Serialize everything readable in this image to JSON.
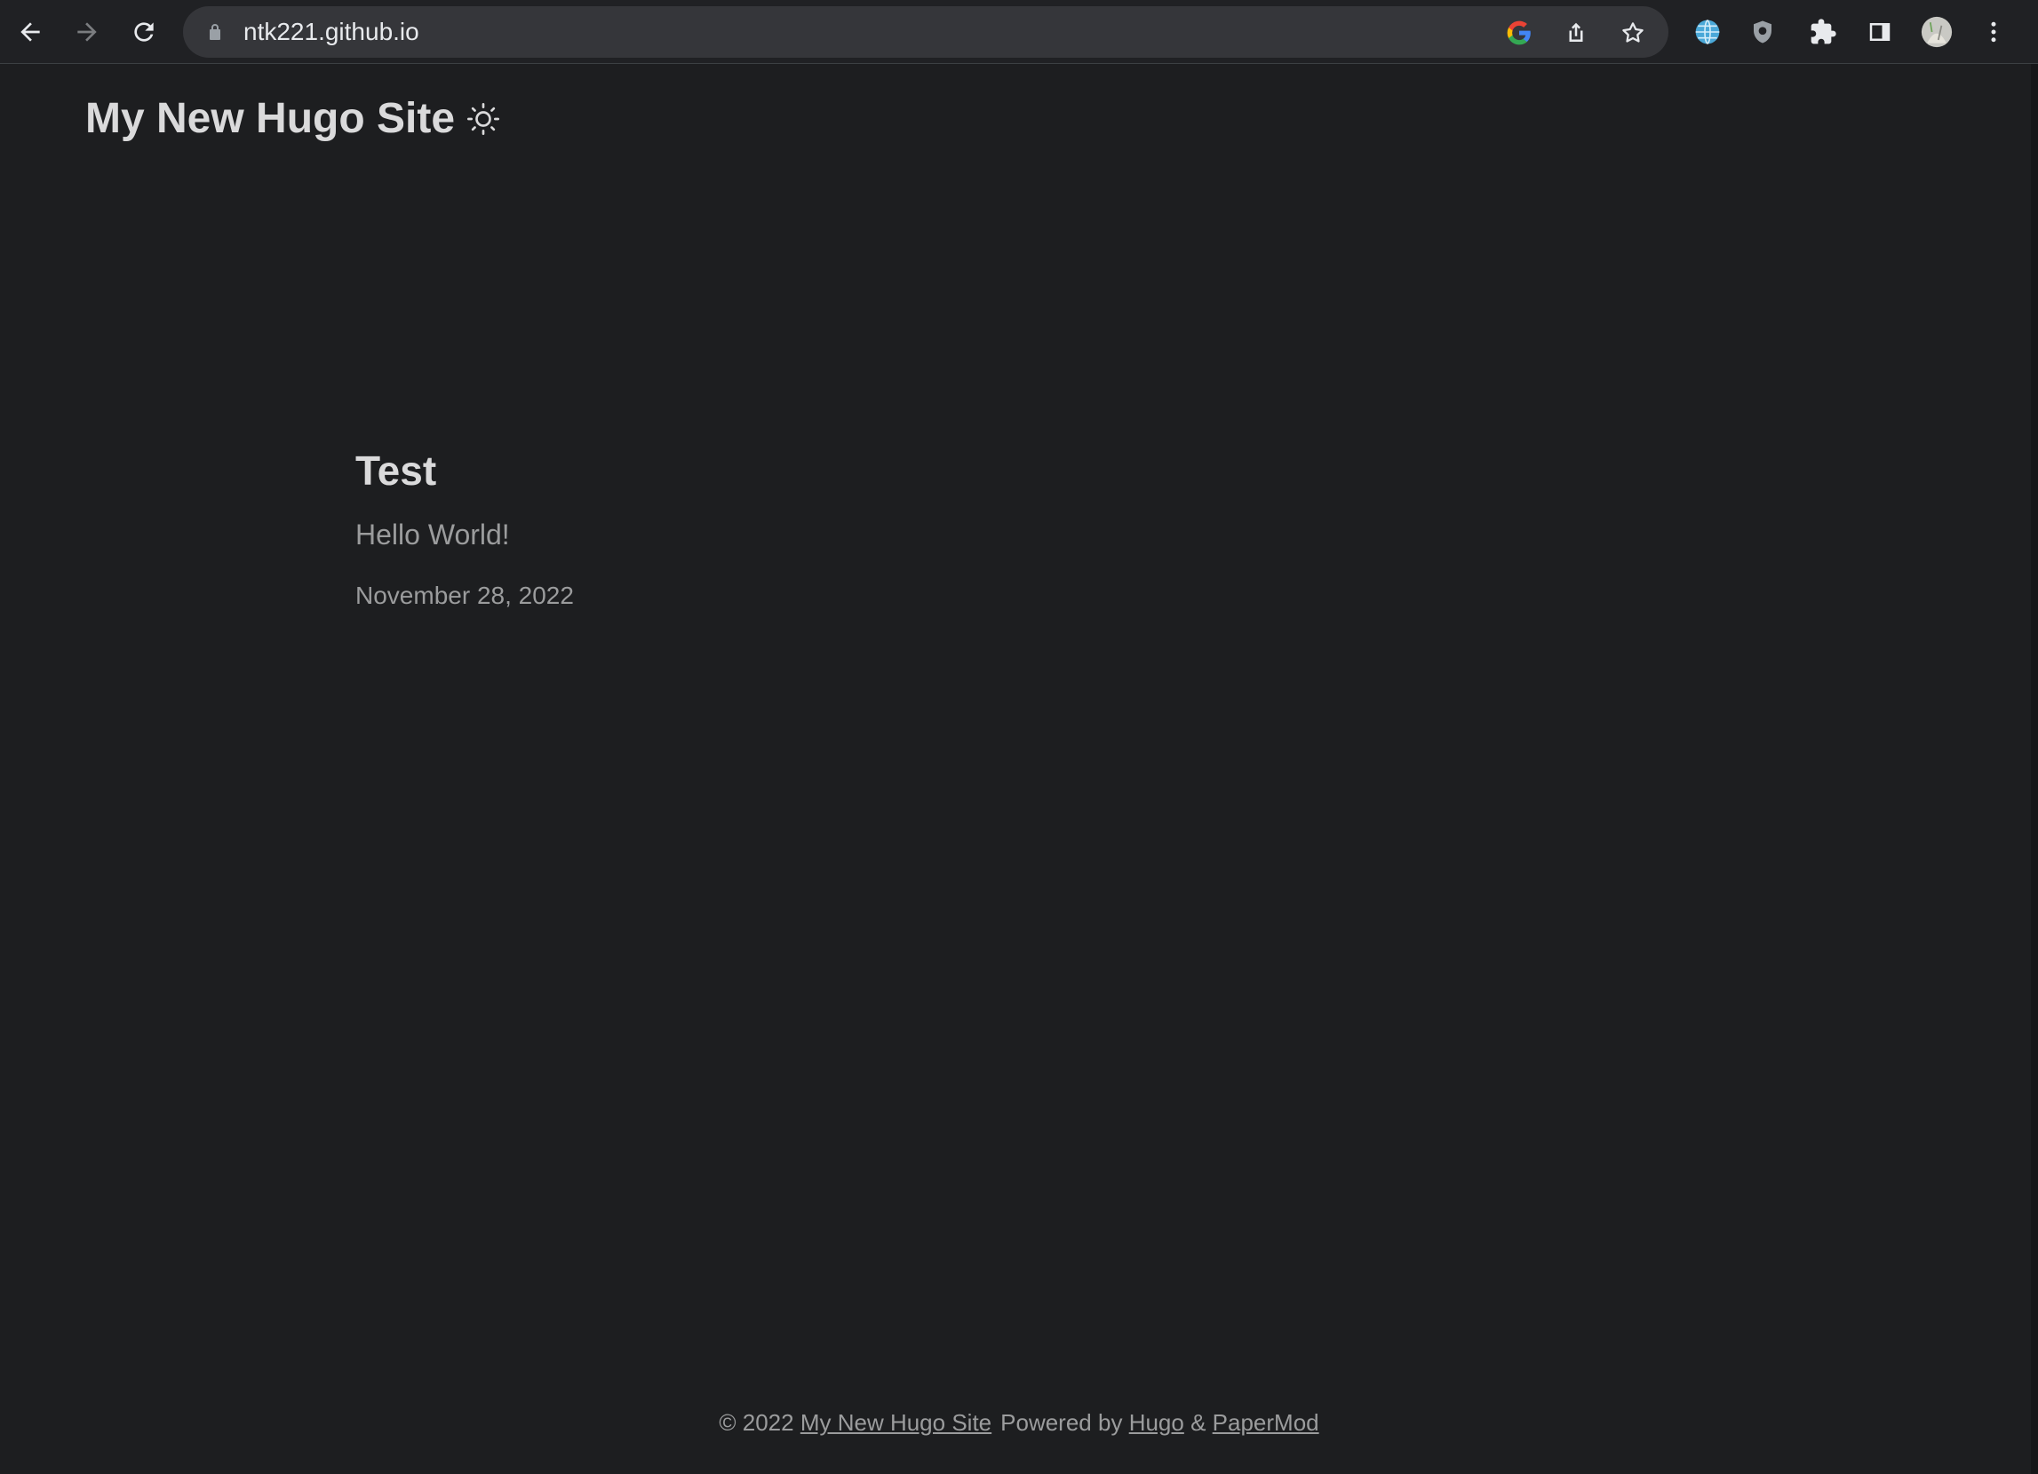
{
  "browser": {
    "url": "ntk221.github.io",
    "icons": [
      "back-arrow-icon",
      "forward-arrow-icon",
      "reload-icon",
      "lock-icon",
      "google-icon",
      "share-icon",
      "star-icon",
      "globe-extension-icon",
      "shield-extension-icon",
      "puzzle-extensions-icon",
      "side-panel-icon",
      "profile-avatar",
      "kebab-menu-icon"
    ]
  },
  "header": {
    "site_title": "My New Hugo Site",
    "theme_toggle_icon": "sun-icon"
  },
  "post": {
    "title": "Test",
    "summary": "Hello World!",
    "date": "November 28, 2022"
  },
  "footer": {
    "copyright": "© 2022",
    "site_link": "My New Hugo Site",
    "powered_by": "Powered by",
    "hugo_link": "Hugo",
    "amp": "&",
    "papermod_link": "PaperMod"
  },
  "colors": {
    "page_background": "#1d1e20",
    "primary_text": "#dadadb",
    "secondary_text": "#9b9c9d",
    "browser_toolbar": "#202124",
    "omnibox": "#35363a"
  }
}
